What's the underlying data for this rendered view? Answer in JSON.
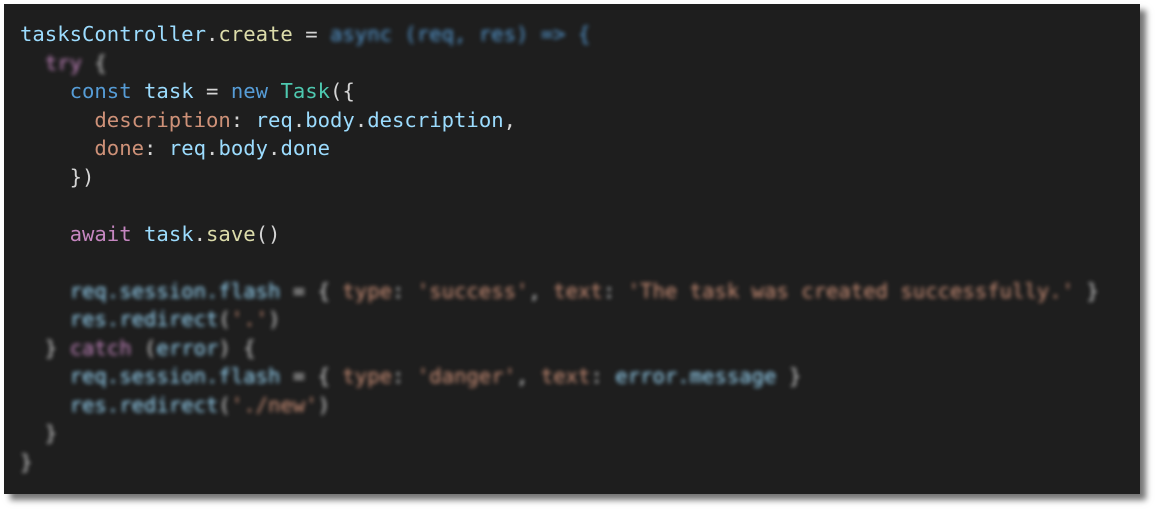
{
  "editor": {
    "theme": {
      "background": "#1e1e1e",
      "variable": "#9cdcfe",
      "function": "#dcdcaa",
      "keyword": "#569cd6",
      "control": "#c586c0",
      "class": "#4ec9b0",
      "string": "#ce9178",
      "punctuation": "#d4d4d4"
    },
    "lines": [
      {
        "blurred": false,
        "tokens": [
          {
            "t": "tasksController",
            "c": "var"
          },
          {
            "t": ".",
            "c": "punc"
          },
          {
            "t": "create",
            "c": "fn"
          },
          {
            "t": " = ",
            "c": "punc"
          },
          {
            "t": "async (req, res) => {",
            "c": "kw",
            "blur": true
          }
        ]
      },
      {
        "blurred": true,
        "tokens": [
          {
            "t": "  ",
            "c": "punc"
          },
          {
            "t": "try",
            "c": "ctrl"
          },
          {
            "t": " {",
            "c": "punc"
          }
        ]
      },
      {
        "blurred": false,
        "tokens": [
          {
            "t": "    ",
            "c": "punc"
          },
          {
            "t": "const",
            "c": "kw"
          },
          {
            "t": " ",
            "c": "punc"
          },
          {
            "t": "task",
            "c": "var"
          },
          {
            "t": " = ",
            "c": "punc"
          },
          {
            "t": "new",
            "c": "kw"
          },
          {
            "t": " ",
            "c": "punc"
          },
          {
            "t": "Task",
            "c": "cls"
          },
          {
            "t": "({",
            "c": "punc"
          }
        ]
      },
      {
        "blurred": false,
        "tokens": [
          {
            "t": "      ",
            "c": "punc"
          },
          {
            "t": "description",
            "c": "prop"
          },
          {
            "t": ": ",
            "c": "punc"
          },
          {
            "t": "req",
            "c": "var"
          },
          {
            "t": ".",
            "c": "punc"
          },
          {
            "t": "body",
            "c": "var"
          },
          {
            "t": ".",
            "c": "punc"
          },
          {
            "t": "description",
            "c": "var"
          },
          {
            "t": ",",
            "c": "punc"
          }
        ]
      },
      {
        "blurred": false,
        "tokens": [
          {
            "t": "      ",
            "c": "punc"
          },
          {
            "t": "done",
            "c": "prop"
          },
          {
            "t": ": ",
            "c": "punc"
          },
          {
            "t": "req",
            "c": "var"
          },
          {
            "t": ".",
            "c": "punc"
          },
          {
            "t": "body",
            "c": "var"
          },
          {
            "t": ".",
            "c": "punc"
          },
          {
            "t": "done",
            "c": "var"
          }
        ]
      },
      {
        "blurred": false,
        "tokens": [
          {
            "t": "    })",
            "c": "punc"
          }
        ]
      },
      {
        "blurred": false,
        "tokens": [
          {
            "t": "",
            "c": "punc"
          }
        ]
      },
      {
        "blurred": false,
        "tokens": [
          {
            "t": "    ",
            "c": "punc"
          },
          {
            "t": "await",
            "c": "ctrl"
          },
          {
            "t": " ",
            "c": "punc"
          },
          {
            "t": "task",
            "c": "var"
          },
          {
            "t": ".",
            "c": "punc"
          },
          {
            "t": "save",
            "c": "fn"
          },
          {
            "t": "()",
            "c": "punc"
          }
        ]
      },
      {
        "blurred": false,
        "tokens": [
          {
            "t": "",
            "c": "punc"
          }
        ]
      },
      {
        "blurred": true,
        "tokens": [
          {
            "t": "    ",
            "c": "punc"
          },
          {
            "t": "req.session.flash",
            "c": "var"
          },
          {
            "t": " = { ",
            "c": "punc"
          },
          {
            "t": "type",
            "c": "prop"
          },
          {
            "t": ": ",
            "c": "punc"
          },
          {
            "t": "'success'",
            "c": "str"
          },
          {
            "t": ", ",
            "c": "punc"
          },
          {
            "t": "text",
            "c": "prop"
          },
          {
            "t": ": ",
            "c": "punc"
          },
          {
            "t": "'The task was created successfully.'",
            "c": "str"
          },
          {
            "t": " }",
            "c": "punc"
          }
        ]
      },
      {
        "blurred": true,
        "tokens": [
          {
            "t": "    ",
            "c": "punc"
          },
          {
            "t": "res.redirect",
            "c": "var"
          },
          {
            "t": "(",
            "c": "punc"
          },
          {
            "t": "'.'",
            "c": "str"
          },
          {
            "t": ")",
            "c": "punc"
          }
        ]
      },
      {
        "blurred": true,
        "tokens": [
          {
            "t": "  } ",
            "c": "punc"
          },
          {
            "t": "catch",
            "c": "ctrl"
          },
          {
            "t": " (",
            "c": "punc"
          },
          {
            "t": "error",
            "c": "var"
          },
          {
            "t": ") {",
            "c": "punc"
          }
        ]
      },
      {
        "blurred": true,
        "tokens": [
          {
            "t": "    ",
            "c": "punc"
          },
          {
            "t": "req.session.flash",
            "c": "var"
          },
          {
            "t": " = { ",
            "c": "punc"
          },
          {
            "t": "type",
            "c": "prop"
          },
          {
            "t": ": ",
            "c": "punc"
          },
          {
            "t": "'danger'",
            "c": "str"
          },
          {
            "t": ", ",
            "c": "punc"
          },
          {
            "t": "text",
            "c": "prop"
          },
          {
            "t": ": ",
            "c": "punc"
          },
          {
            "t": "error.message",
            "c": "var"
          },
          {
            "t": " }",
            "c": "punc"
          }
        ]
      },
      {
        "blurred": true,
        "tokens": [
          {
            "t": "    ",
            "c": "punc"
          },
          {
            "t": "res.redirect",
            "c": "var"
          },
          {
            "t": "(",
            "c": "punc"
          },
          {
            "t": "'./new'",
            "c": "str"
          },
          {
            "t": ")",
            "c": "punc"
          }
        ]
      },
      {
        "blurred": true,
        "tokens": [
          {
            "t": "  }",
            "c": "punc"
          }
        ]
      },
      {
        "blurred": true,
        "tokens": [
          {
            "t": "}",
            "c": "punc"
          }
        ]
      }
    ]
  }
}
